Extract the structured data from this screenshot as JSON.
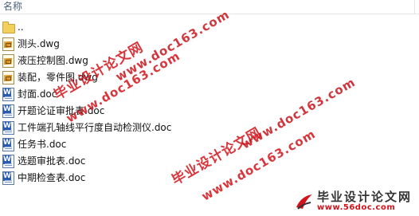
{
  "header": {
    "name_column_label": "名称"
  },
  "files": [
    {
      "name": "..",
      "kind": "folder",
      "icon": "folder-up-icon"
    },
    {
      "name": "测头.dwg",
      "kind": "dwg",
      "icon": "dwg-file-icon"
    },
    {
      "name": "液压控制图.dwg",
      "kind": "dwg",
      "icon": "dwg-file-icon"
    },
    {
      "name": "装配，零件图.dwg",
      "kind": "dwg",
      "icon": "dwg-file-icon"
    },
    {
      "name": "封面.doc",
      "kind": "doc",
      "icon": "word-doc-icon"
    },
    {
      "name": "开题论证审批表.doc",
      "kind": "doc",
      "icon": "word-doc-icon"
    },
    {
      "name": "工件端孔轴线平行度自动检测仪.doc",
      "kind": "doc",
      "icon": "word-doc-icon"
    },
    {
      "name": "任务书.doc",
      "kind": "doc",
      "icon": "word-doc-icon"
    },
    {
      "name": "选题审批表.doc",
      "kind": "doc",
      "icon": "word-doc-icon"
    },
    {
      "name": "中期检查表.doc",
      "kind": "doc",
      "icon": "word-doc-icon"
    }
  ],
  "watermarks": {
    "site_name": "毕业设计论文网",
    "site_url": "www.doc163.com",
    "logo_title": "毕业设计论文网",
    "logo_url": "www.56doc.com"
  },
  "colors": {
    "watermark_red": "#d3121a",
    "header_text": "#4c607a"
  }
}
